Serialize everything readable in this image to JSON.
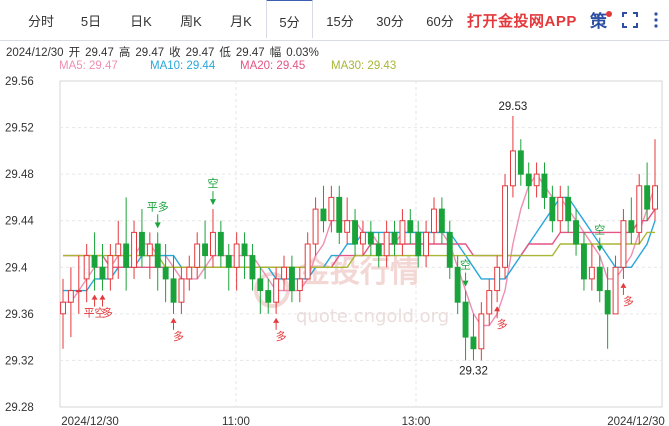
{
  "tabs": [
    {
      "label": "分时",
      "active": false
    },
    {
      "label": "5日",
      "active": false
    },
    {
      "label": "日K",
      "active": false
    },
    {
      "label": "周K",
      "active": false
    },
    {
      "label": "月K",
      "active": false
    },
    {
      "label": "5分",
      "active": true
    },
    {
      "label": "15分",
      "active": false
    },
    {
      "label": "30分",
      "active": false
    },
    {
      "label": "60分",
      "active": false
    }
  ],
  "header": {
    "app_link": "打开金投网APP",
    "strategy": "策",
    "fullscreen_icon": "fullscreen-icon",
    "more_icon": "more-vertical-icon"
  },
  "quote": {
    "date": "2024/12/30",
    "open_label": "开",
    "open": "29.47",
    "high_label": "高",
    "high": "29.47",
    "close_label": "收",
    "close": "29.47",
    "low_label": "低",
    "low": "29.47",
    "change_label": "幅",
    "change": "0.03%"
  },
  "ma_legend": [
    {
      "label": "MA5: 29.47",
      "color": "#ef8fb3"
    },
    {
      "label": "MA10: 29.44",
      "color": "#29a7d9"
    },
    {
      "label": "MA20: 29.45",
      "color": "#e35582"
    },
    {
      "label": "MA30: 29.43",
      "color": "#a8b636"
    }
  ],
  "watermark": {
    "text": "金投行情",
    "url": "quote.cngold.org"
  },
  "chart_data": {
    "type": "candlestick",
    "ylim": [
      29.28,
      29.56
    ],
    "y_ticks": [
      "29.56",
      "29.52",
      "29.48",
      "29.44",
      "29.4",
      "29.36",
      "29.32",
      "29.28"
    ],
    "x_ticks": [
      "2024/12/30",
      "11:00",
      "13:00",
      "2024/12/30"
    ],
    "grid": true,
    "up_color": "#e4393c",
    "down_color": "#1aa33a",
    "candles": [
      [
        29.36,
        29.37,
        29.39,
        29.33
      ],
      [
        29.37,
        29.38,
        29.4,
        29.34
      ],
      [
        29.38,
        29.38,
        29.41,
        29.36
      ],
      [
        29.39,
        29.41,
        29.42,
        29.37
      ],
      [
        29.41,
        29.4,
        29.43,
        29.38
      ],
      [
        29.4,
        29.39,
        29.42,
        29.38
      ],
      [
        29.39,
        29.41,
        29.42,
        29.38
      ],
      [
        29.41,
        29.42,
        29.44,
        29.39
      ],
      [
        29.42,
        29.4,
        29.46,
        29.38
      ],
      [
        29.4,
        29.43,
        29.44,
        29.39
      ],
      [
        29.43,
        29.41,
        29.45,
        29.4
      ],
      [
        29.41,
        29.42,
        29.43,
        29.39
      ],
      [
        29.42,
        29.4,
        29.43,
        29.38
      ],
      [
        29.4,
        29.39,
        29.42,
        29.37
      ],
      [
        29.39,
        29.37,
        29.41,
        29.36
      ],
      [
        29.37,
        29.39,
        29.4,
        29.36
      ],
      [
        29.39,
        29.4,
        29.41,
        29.38
      ],
      [
        29.4,
        29.42,
        29.43,
        29.39
      ],
      [
        29.42,
        29.41,
        29.44,
        29.39
      ],
      [
        29.41,
        29.43,
        29.45,
        29.4
      ],
      [
        29.43,
        29.41,
        29.44,
        29.4
      ],
      [
        29.41,
        29.4,
        29.42,
        29.38
      ],
      [
        29.4,
        29.42,
        29.43,
        29.38
      ],
      [
        29.42,
        29.41,
        29.43,
        29.39
      ],
      [
        29.41,
        29.39,
        29.42,
        29.38
      ],
      [
        29.39,
        29.38,
        29.4,
        29.36
      ],
      [
        29.38,
        29.37,
        29.39,
        29.36
      ],
      [
        29.37,
        29.39,
        29.4,
        29.36
      ],
      [
        29.39,
        29.4,
        29.41,
        29.38
      ],
      [
        29.4,
        29.38,
        29.41,
        29.37
      ],
      [
        29.38,
        29.39,
        29.4,
        29.37
      ],
      [
        29.39,
        29.42,
        29.43,
        29.39
      ],
      [
        29.42,
        29.45,
        29.46,
        29.41
      ],
      [
        29.45,
        29.44,
        29.47,
        29.43
      ],
      [
        29.44,
        29.46,
        29.47,
        29.43
      ],
      [
        29.46,
        29.43,
        29.47,
        29.42
      ],
      [
        29.43,
        29.44,
        29.46,
        29.42
      ],
      [
        29.44,
        29.42,
        29.45,
        29.41
      ],
      [
        29.42,
        29.43,
        29.44,
        29.41
      ],
      [
        29.43,
        29.42,
        29.44,
        29.41
      ],
      [
        29.42,
        29.41,
        29.43,
        29.4
      ],
      [
        29.41,
        29.43,
        29.44,
        29.4
      ],
      [
        29.43,
        29.42,
        29.44,
        29.41
      ],
      [
        29.42,
        29.44,
        29.45,
        29.41
      ],
      [
        29.44,
        29.43,
        29.45,
        29.42
      ],
      [
        29.43,
        29.41,
        29.44,
        29.4
      ],
      [
        29.41,
        29.43,
        29.44,
        29.4
      ],
      [
        29.43,
        29.45,
        29.46,
        29.42
      ],
      [
        29.45,
        29.43,
        29.46,
        29.42
      ],
      [
        29.43,
        29.4,
        29.44,
        29.39
      ],
      [
        29.4,
        29.37,
        29.41,
        29.36
      ],
      [
        29.37,
        29.34,
        29.38,
        29.32
      ],
      [
        29.34,
        29.33,
        29.36,
        29.32
      ],
      [
        29.33,
        29.36,
        29.37,
        29.32
      ],
      [
        29.36,
        29.38,
        29.39,
        29.35
      ],
      [
        29.38,
        29.4,
        29.41,
        29.37
      ],
      [
        29.4,
        29.47,
        29.48,
        29.39
      ],
      [
        29.47,
        29.5,
        29.53,
        29.46
      ],
      [
        29.5,
        29.48,
        29.51,
        29.47
      ],
      [
        29.48,
        29.47,
        29.49,
        29.45
      ],
      [
        29.47,
        29.48,
        29.49,
        29.46
      ],
      [
        29.48,
        29.46,
        29.49,
        29.45
      ],
      [
        29.46,
        29.44,
        29.47,
        29.43
      ],
      [
        29.44,
        29.46,
        29.47,
        29.43
      ],
      [
        29.46,
        29.44,
        29.47,
        29.43
      ],
      [
        29.44,
        29.42,
        29.45,
        29.41
      ],
      [
        29.42,
        29.39,
        29.43,
        29.38
      ],
      [
        29.39,
        29.4,
        29.42,
        29.38
      ],
      [
        29.4,
        29.38,
        29.41,
        29.37
      ],
      [
        29.38,
        29.36,
        29.4,
        29.33
      ],
      [
        29.36,
        29.4,
        29.41,
        29.36
      ],
      [
        29.4,
        29.44,
        29.45,
        29.39
      ],
      [
        29.44,
        29.43,
        29.46,
        29.42
      ],
      [
        29.43,
        29.47,
        29.48,
        29.42
      ],
      [
        29.47,
        29.45,
        29.49,
        29.44
      ],
      [
        29.45,
        29.47,
        29.51,
        29.44
      ]
    ],
    "series": [
      {
        "name": "MA5",
        "color": "#ef8fb3",
        "values": [
          29.37,
          29.37,
          29.38,
          29.39,
          29.4,
          29.4,
          29.4,
          29.41,
          29.41,
          29.41,
          29.42,
          29.42,
          29.41,
          29.41,
          29.4,
          29.39,
          29.39,
          29.39,
          29.4,
          29.41,
          29.41,
          29.41,
          29.41,
          29.41,
          29.41,
          29.4,
          29.39,
          29.38,
          29.38,
          29.38,
          29.38,
          29.39,
          29.41,
          29.42,
          29.44,
          29.44,
          29.44,
          29.44,
          29.43,
          29.43,
          29.42,
          29.42,
          29.42,
          29.43,
          29.43,
          29.43,
          29.43,
          29.43,
          29.43,
          29.42,
          29.4,
          29.38,
          29.36,
          29.35,
          29.35,
          29.36,
          29.38,
          29.42,
          29.45,
          29.47,
          29.48,
          29.47,
          29.46,
          29.46,
          29.45,
          29.44,
          29.43,
          29.42,
          29.41,
          29.39,
          29.39,
          29.4,
          29.41,
          29.43,
          29.45,
          29.47
        ]
      },
      {
        "name": "MA10",
        "color": "#29a7d9",
        "values": [
          29.38,
          29.38,
          29.38,
          29.38,
          29.39,
          29.39,
          29.39,
          29.4,
          29.4,
          29.4,
          29.41,
          29.41,
          29.41,
          29.41,
          29.41,
          29.4,
          29.4,
          29.4,
          29.4,
          29.4,
          29.4,
          29.4,
          29.4,
          29.4,
          29.4,
          29.4,
          29.4,
          29.39,
          29.39,
          29.39,
          29.39,
          29.39,
          29.4,
          29.4,
          29.41,
          29.41,
          29.42,
          29.42,
          29.43,
          29.43,
          29.43,
          29.43,
          29.43,
          29.43,
          29.43,
          29.43,
          29.43,
          29.43,
          29.43,
          29.43,
          29.42,
          29.41,
          29.4,
          29.39,
          29.39,
          29.39,
          29.39,
          29.4,
          29.41,
          29.42,
          29.43,
          29.44,
          29.45,
          29.46,
          29.46,
          29.45,
          29.44,
          29.43,
          29.42,
          29.41,
          29.4,
          29.4,
          29.4,
          29.41,
          29.42,
          29.44
        ]
      },
      {
        "name": "MA20",
        "color": "#e35582",
        "values": [
          29.41,
          29.41,
          29.41,
          29.41,
          29.41,
          29.41,
          29.4,
          29.4,
          29.4,
          29.4,
          29.4,
          29.4,
          29.4,
          29.4,
          29.4,
          29.4,
          29.4,
          29.4,
          29.4,
          29.4,
          29.4,
          29.4,
          29.4,
          29.4,
          29.4,
          29.4,
          29.4,
          29.4,
          29.4,
          29.4,
          29.4,
          29.4,
          29.4,
          29.4,
          29.4,
          29.41,
          29.41,
          29.41,
          29.41,
          29.42,
          29.42,
          29.42,
          29.42,
          29.42,
          29.42,
          29.42,
          29.42,
          29.42,
          29.42,
          29.42,
          29.42,
          29.42,
          29.41,
          29.41,
          29.41,
          29.41,
          29.41,
          29.41,
          29.41,
          29.42,
          29.42,
          29.42,
          29.42,
          29.43,
          29.43,
          29.43,
          29.43,
          29.43,
          29.43,
          29.43,
          29.43,
          29.43,
          29.43,
          29.44,
          29.44,
          29.45
        ]
      },
      {
        "name": "MA30",
        "color": "#a8b636",
        "values": [
          29.41,
          29.41,
          29.41,
          29.41,
          29.41,
          29.41,
          29.41,
          29.41,
          29.41,
          29.41,
          29.41,
          29.41,
          29.41,
          29.4,
          29.4,
          29.4,
          29.4,
          29.4,
          29.4,
          29.4,
          29.4,
          29.4,
          29.4,
          29.4,
          29.4,
          29.4,
          29.4,
          29.4,
          29.4,
          29.4,
          29.4,
          29.4,
          29.4,
          29.4,
          29.4,
          29.4,
          29.4,
          29.41,
          29.41,
          29.41,
          29.41,
          29.41,
          29.41,
          29.41,
          29.41,
          29.41,
          29.41,
          29.41,
          29.41,
          29.41,
          29.41,
          29.41,
          29.41,
          29.41,
          29.41,
          29.41,
          29.41,
          29.41,
          29.41,
          29.41,
          29.41,
          29.41,
          29.41,
          29.42,
          29.42,
          29.42,
          29.42,
          29.42,
          29.42,
          29.42,
          29.42,
          29.42,
          29.42,
          29.42,
          29.43,
          29.43
        ]
      }
    ],
    "annotations": [
      {
        "label": "29.53",
        "candle": 57,
        "price": 29.53,
        "kind": "high"
      },
      {
        "label": "29.32",
        "candle": 52,
        "price": 29.32,
        "kind": "low"
      }
    ],
    "signals": [
      {
        "label": "平空",
        "candle": 4,
        "side": "buy"
      },
      {
        "label": "多",
        "candle": 5,
        "side": "buy"
      },
      {
        "label": "平多",
        "candle": 12,
        "side": "sell"
      },
      {
        "label": "多",
        "candle": 14,
        "side": "buy"
      },
      {
        "label": "空",
        "candle": 19,
        "side": "sell"
      },
      {
        "label": "多",
        "candle": 27,
        "side": "buy"
      },
      {
        "label": "空",
        "candle": 51,
        "side": "sell"
      },
      {
        "label": "多",
        "candle": 55,
        "side": "buy"
      },
      {
        "label": "空",
        "candle": 68,
        "side": "sell"
      },
      {
        "label": "多",
        "candle": 71,
        "side": "buy"
      }
    ]
  }
}
